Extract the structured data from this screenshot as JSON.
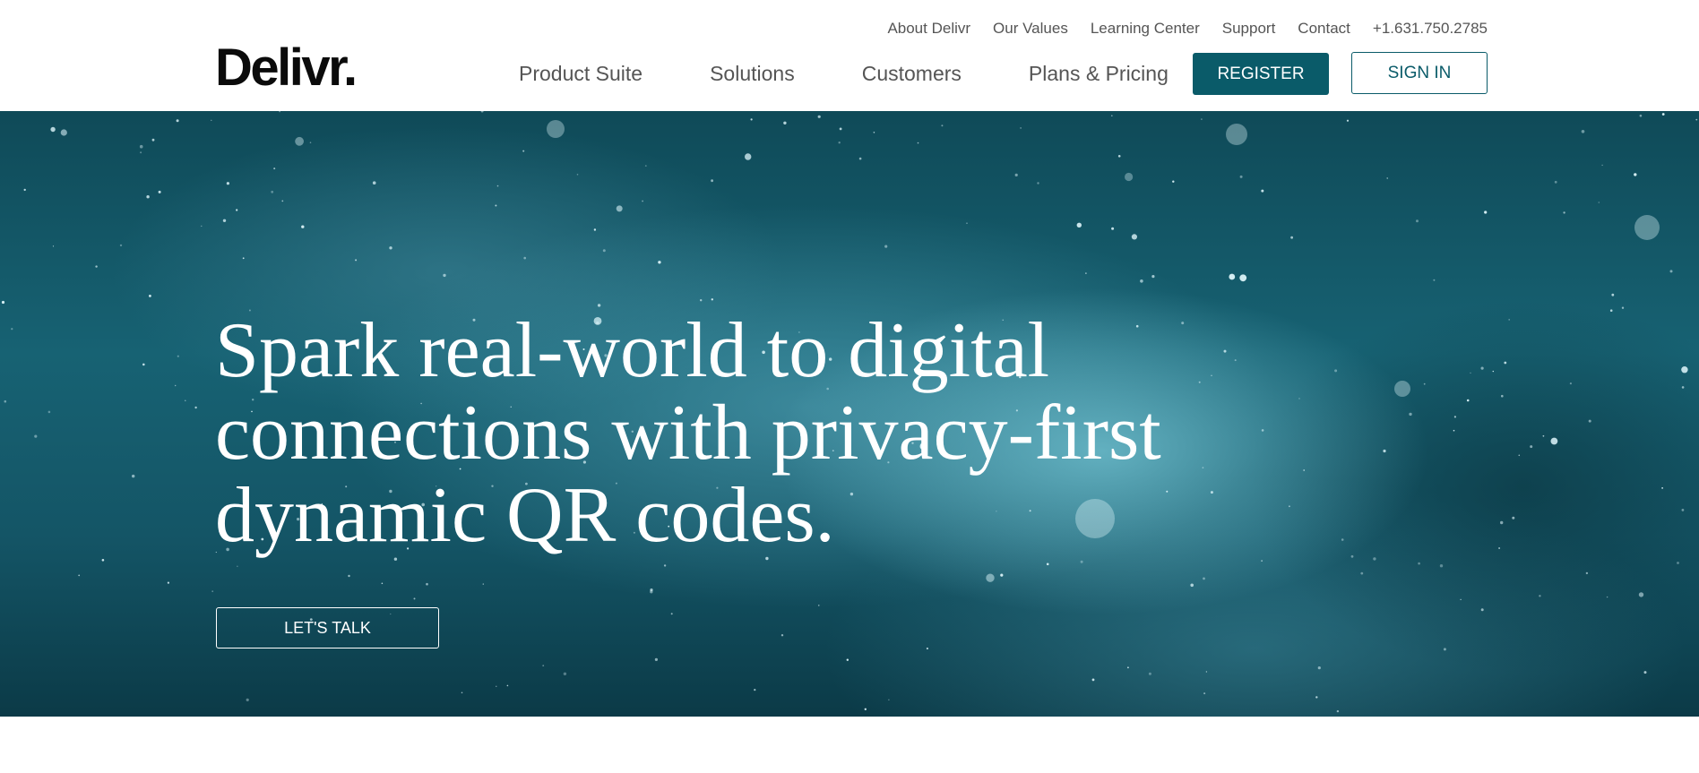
{
  "brand": {
    "logo_text": "Delivr."
  },
  "utility_nav": [
    "About Delivr",
    "Our Values",
    "Learning Center",
    "Support",
    "Contact",
    "+1.631.750.2785"
  ],
  "main_nav": [
    "Product Suite",
    "Solutions",
    "Customers",
    "Plans & Pricing"
  ],
  "actions": {
    "register_label": "REGISTER",
    "signin_label": "SIGN IN"
  },
  "hero": {
    "headline": "Spark real-world to digital connections with privacy-first dynamic QR codes.",
    "cta_label": "LET'S TALK"
  },
  "colors": {
    "accent": "#0a5b69",
    "hero_dark": "#0b3a47",
    "hero_light": "#7fc8d6"
  }
}
